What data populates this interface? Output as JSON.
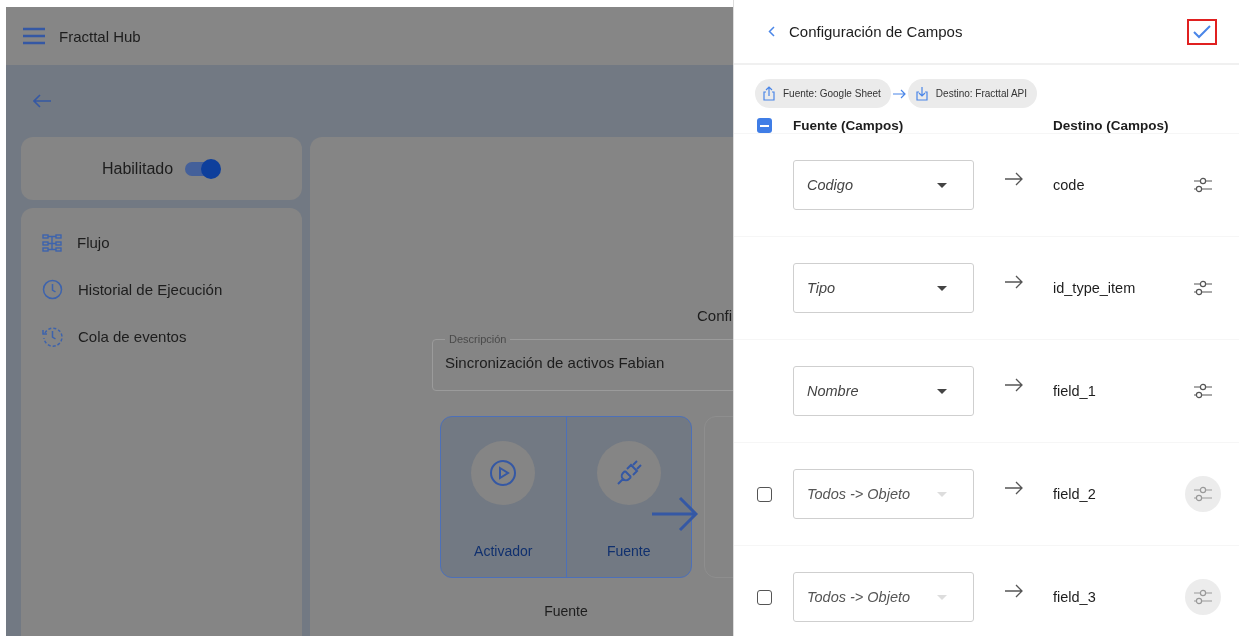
{
  "app_bar": {
    "title": "Fracttal Hub"
  },
  "status_card": {
    "label": "Habilitado",
    "on": true
  },
  "nav": [
    {
      "kind": "flow",
      "label": "Flujo"
    },
    {
      "kind": "history",
      "label": "Historial de Ejecución"
    },
    {
      "kind": "queue",
      "label": "Cola de eventos"
    }
  ],
  "main": {
    "heading": "Confi",
    "description": {
      "label": "Descripción",
      "value": "Sincronización de activos Fabian"
    },
    "steps": [
      {
        "kind": "trigger",
        "label": "Activador"
      },
      {
        "kind": "source",
        "label": "Fuente"
      }
    ],
    "caption": "Fuente"
  },
  "drawer": {
    "title": "Configuración de Campos",
    "chips": [
      {
        "kind": "upload",
        "label": "Fuente: Google Sheet"
      },
      {
        "kind": "download",
        "label": "Destino: Fracttal API"
      }
    ],
    "columns": [
      "Fuente (Campos)",
      "Destino (Campos)"
    ],
    "select_all": {
      "indeterminate": true
    },
    "rows": [
      {
        "kind": "fixed",
        "source": "Codigo",
        "target": "code",
        "disabled": false
      },
      {
        "kind": "fixed",
        "source": "Tipo",
        "target": "id_type_item",
        "disabled": false
      },
      {
        "kind": "fixed",
        "source": "Nombre",
        "target": "field_1",
        "disabled": false
      },
      {
        "kind": "optional",
        "checked": false,
        "source": "Todos -> Objeto",
        "target": "field_2",
        "disabled": true
      },
      {
        "kind": "optional",
        "checked": false,
        "source": "Todos -> Objeto",
        "target": "field_3",
        "disabled": true
      }
    ]
  }
}
